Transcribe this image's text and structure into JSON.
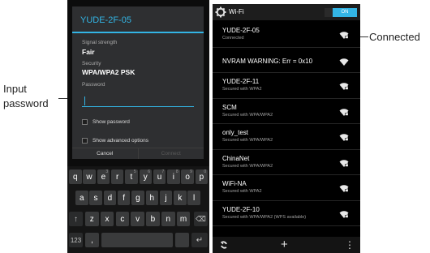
{
  "annotations": {
    "input_password": [
      "Input",
      "password"
    ],
    "connected": "Connected"
  },
  "dialog": {
    "title": "YUDE-2F-05",
    "signal_label": "Signal strength",
    "signal_value": "Fair",
    "security_label": "Security",
    "security_value": "WPA/WPA2 PSK",
    "password_label": "Password",
    "password_value": "",
    "show_password": "Show password",
    "show_advanced": "Show advanced options",
    "cancel": "Cancel",
    "connect": "Connect"
  },
  "keyboard": {
    "row1": [
      {
        "k": "q",
        "h": ""
      },
      {
        "k": "w",
        "h": ""
      },
      {
        "k": "e",
        "h": "3"
      },
      {
        "k": "r",
        "h": ""
      },
      {
        "k": "t",
        "h": "5"
      },
      {
        "k": "y",
        "h": "6"
      },
      {
        "k": "u",
        "h": "7"
      },
      {
        "k": "i",
        "h": "8"
      },
      {
        "k": "o",
        "h": "9"
      },
      {
        "k": "p",
        "h": "0"
      }
    ],
    "row2": [
      "a",
      "s",
      "d",
      "f",
      "g",
      "h",
      "j",
      "k",
      "l"
    ],
    "row3": [
      "z",
      "x",
      "c",
      "v",
      "b",
      "n",
      "m"
    ],
    "shift": "↑",
    "backspace": "⌫",
    "numbers": "123",
    "comma": ",",
    "enter": "↵"
  },
  "wifi": {
    "title": "Wi-Fi",
    "toggle": "ON",
    "networks": [
      {
        "name": "YUDE-2F-05",
        "status": "Connected",
        "icon": "wifi-lock-icon"
      },
      {
        "name": "NVRAM WARNING: Err = 0x10",
        "status": "",
        "icon": "wifi-icon"
      },
      {
        "name": "YUDE-2F-11",
        "status": "Secured with WPA2",
        "icon": "wifi-lock-icon"
      },
      {
        "name": "SCM",
        "status": "Secured with WPA/WPA2",
        "icon": "wifi-lock-icon"
      },
      {
        "name": "only_test",
        "status": "Secured with WPA/WPA2",
        "icon": "wifi-lock-icon"
      },
      {
        "name": "ChinaNet",
        "status": "Secured with WPA/WPA2",
        "icon": "wifi-lock-icon"
      },
      {
        "name": "WiFi-NA",
        "status": "Secured with WPA2",
        "icon": "wifi-lock-icon"
      },
      {
        "name": "YUDE-2F-10",
        "status": "Secured with WPA/WPA2 (WPS available)",
        "icon": "wifi-lock-icon"
      }
    ],
    "add_label": "+",
    "menu_label": "⋮"
  },
  "colors": {
    "accent": "#33b5e5",
    "dialog_bg": "#2e2f31",
    "list_bg": "#000000"
  }
}
